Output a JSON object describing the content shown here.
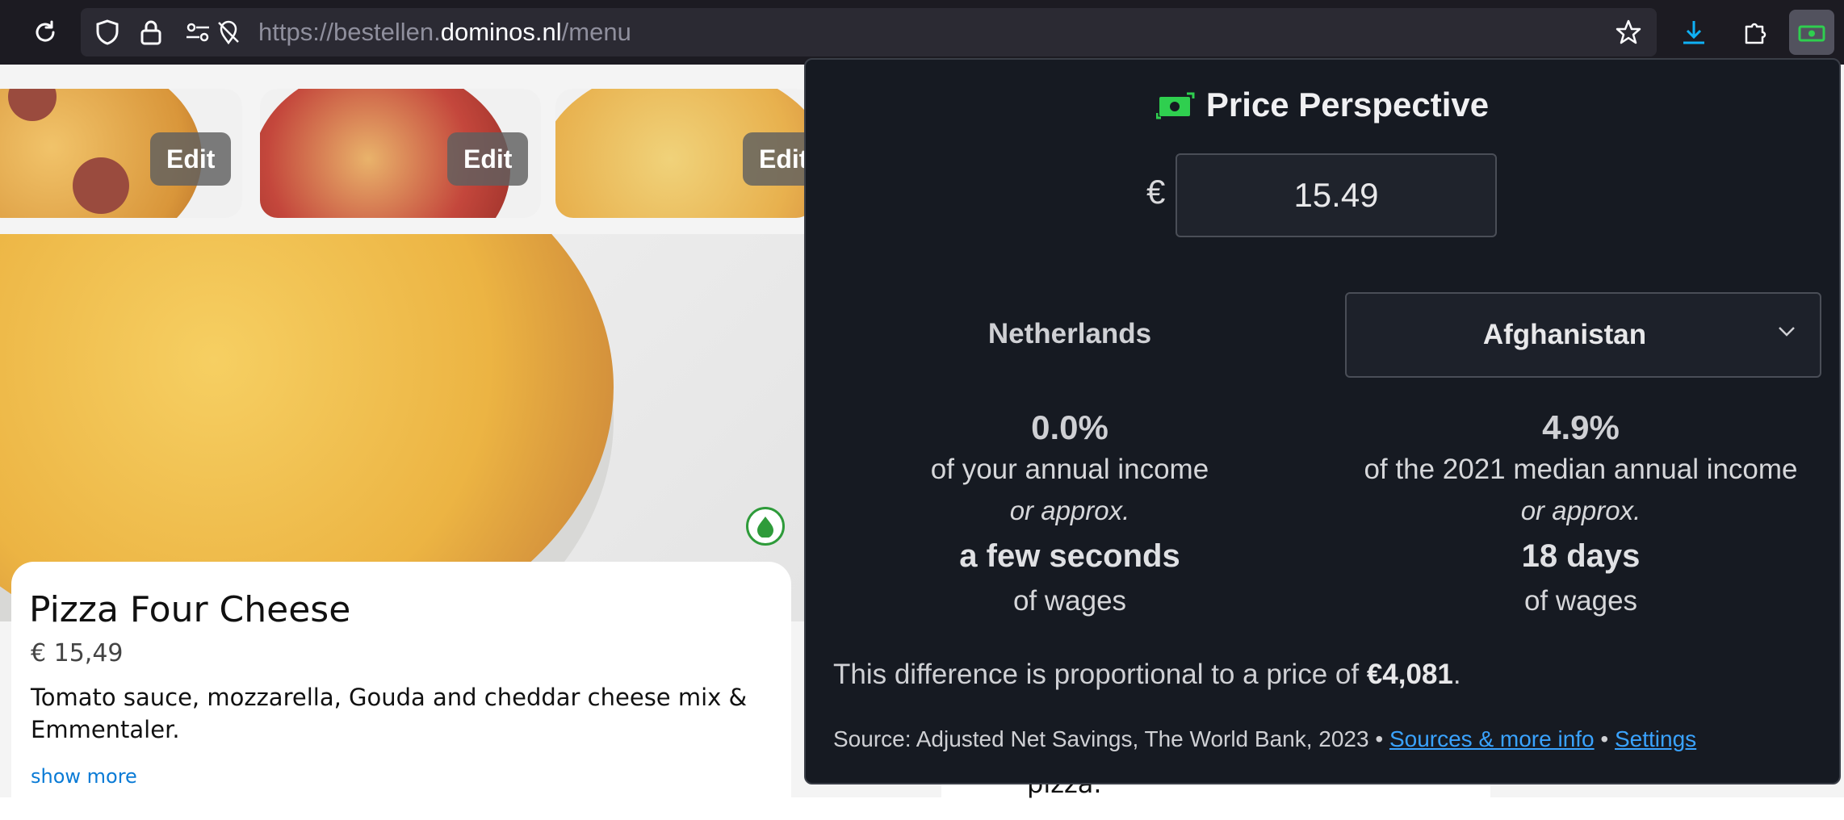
{
  "browser": {
    "url_prefix": "https://bestellen.",
    "url_host": "dominos.nl",
    "url_path": "/menu"
  },
  "menu": {
    "thumbnails": [
      {
        "edit_label": "Edit"
      },
      {
        "edit_label": "Edit"
      },
      {
        "edit_label": "Edit"
      }
    ],
    "product": {
      "title": "Pizza Four Cheese",
      "price": "€ 15,49",
      "description": "Tomato sauce, mozzarella, Gouda and cheddar cheese mix & Emmentaler.",
      "show_more": "show more"
    },
    "behind_text": "pizza."
  },
  "popup": {
    "title": "Price Perspective",
    "currency_symbol": "€",
    "price_value": "15.49",
    "home_country": "Netherlands",
    "compare_country": "Afghanistan",
    "home": {
      "percent": "0.0%",
      "income_label": "of your annual income",
      "approx_label": "or approx.",
      "duration": "a few seconds",
      "wages_label": "of wages"
    },
    "compare": {
      "percent": "4.9%",
      "income_label": "of the 2021 median annual income",
      "approx_label": "or approx.",
      "duration": "18 days",
      "wages_label": "of wages"
    },
    "difference_text": "This difference is proportional to a price of",
    "difference_value": "€4,081",
    "difference_end": ".",
    "source_text": "Source: Adjusted Net Savings, The World Bank, 2023 •",
    "sources_link": "Sources & more info",
    "separator": "•",
    "settings_link": "Settings"
  },
  "colors": {
    "popup_bg": "#161a22",
    "link": "#3aa3ff",
    "accent_green": "#2fcf4f"
  }
}
